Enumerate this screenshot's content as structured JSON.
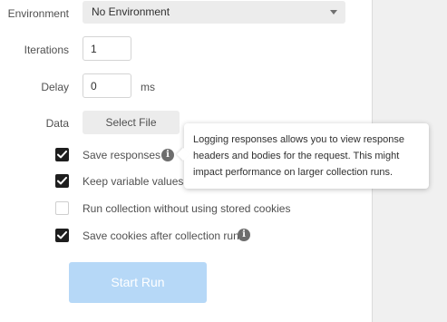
{
  "environment": {
    "label": "Environment",
    "selected": "No Environment"
  },
  "iterations": {
    "label": "Iterations",
    "value": "1"
  },
  "delay": {
    "label": "Delay",
    "value": "0",
    "unit": "ms"
  },
  "data": {
    "label": "Data",
    "button_label": "Select File"
  },
  "options": [
    {
      "label": "Save responses",
      "checked": true,
      "has_info": true
    },
    {
      "label": "Keep variable values",
      "checked": true,
      "has_info": false
    },
    {
      "label": "Run collection without using stored cookies",
      "checked": false,
      "has_info": false
    },
    {
      "label": "Save cookies after collection run",
      "checked": true,
      "has_info": true
    }
  ],
  "tooltip": {
    "text": "Logging responses allows you to view response headers and bodies for the request. This might impact performance on larger collection runs."
  },
  "start_button": {
    "label": "Start Run"
  },
  "colors": {
    "checkbox_checked": "#1e1e1e",
    "start_button_bg": "#b6d8f7"
  }
}
